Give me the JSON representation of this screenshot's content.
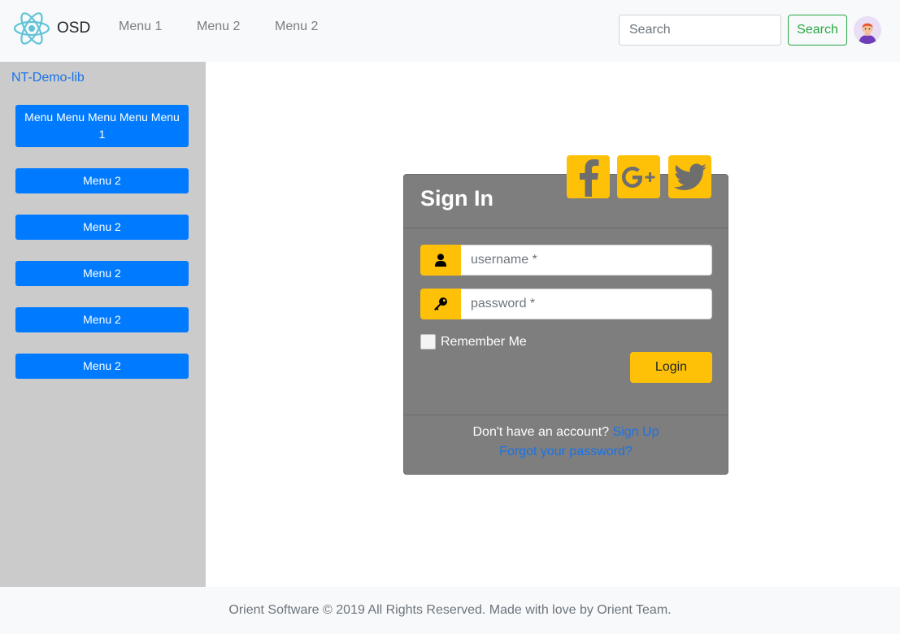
{
  "navbar": {
    "brand": "OSD",
    "logo_icon": "react-atom-icon",
    "links": [
      "Menu 1",
      "Menu 2",
      "Menu 2"
    ],
    "search_placeholder": "Search",
    "search_button": "Search",
    "avatar_icon": "user-avatar-icon"
  },
  "sidebar": {
    "title": "NT-Demo-lib",
    "items": [
      "Menu Menu Menu Menu Menu 1",
      "Menu 2",
      "Menu 2",
      "Menu 2",
      "Menu 2",
      "Menu 2"
    ]
  },
  "login": {
    "title": "Sign In",
    "social": [
      "facebook-icon",
      "google-plus-icon",
      "twitter-icon"
    ],
    "username_placeholder": "username *",
    "password_placeholder": "password *",
    "remember_label": "Remember Me",
    "login_button": "Login",
    "no_account_text": "Don't have an account?",
    "signup_link": "Sign Up",
    "forgot_link": "Forgot your password?"
  },
  "footer": {
    "copyright": "Orient Software © 2019 All Rights Reserved. Made with love by Orient Team."
  },
  "colors": {
    "primary": "#007bff",
    "warning": "#ffc107",
    "success": "#28a745",
    "card": "#7e7e7e",
    "sidebar": "#cbcbcb"
  }
}
